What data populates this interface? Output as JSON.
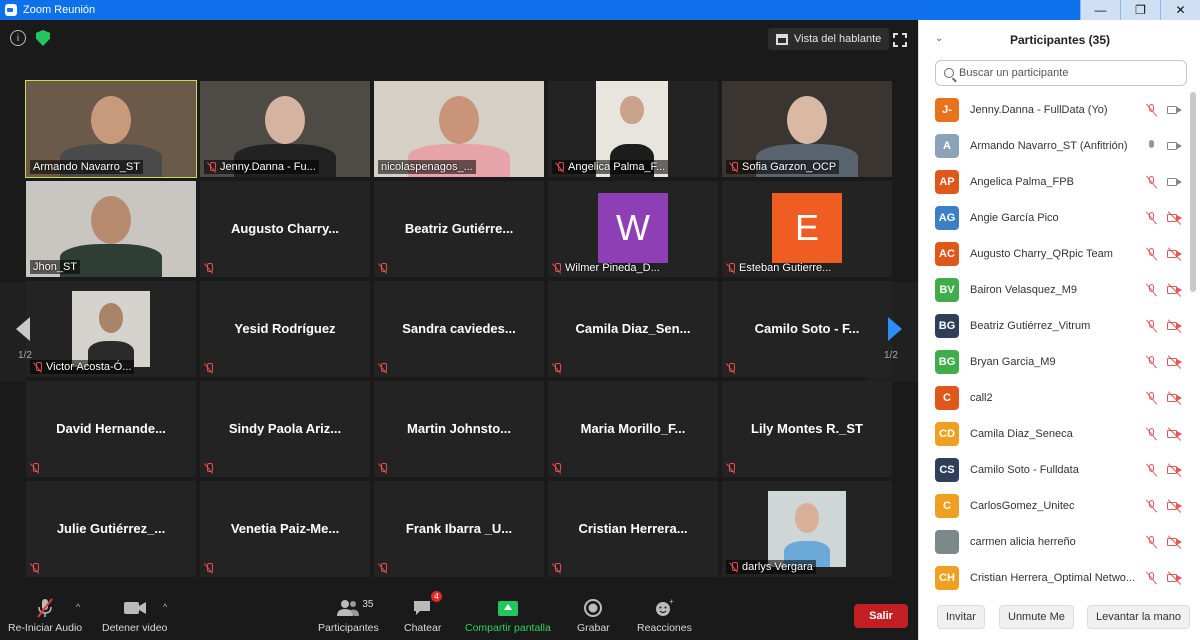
{
  "window": {
    "title": "Zoom Reunión",
    "minimize": "—",
    "maximize": "❐",
    "close": "✕"
  },
  "video": {
    "speaker_view_label": "Vista del hablante",
    "page_left": "1/2",
    "page_right": "1/2",
    "tiles": [
      {
        "name": "Armando Navarro_ST",
        "kind": "camera",
        "muted": false,
        "active": true,
        "bg": "#6b5a4a",
        "skin": "#c79a7c",
        "shirt": "#4a4a4a"
      },
      {
        "name": "Jenny.Danna - Fu...",
        "kind": "camera",
        "muted": true,
        "bg": "#4e4a45",
        "skin": "#d4b4a0",
        "shirt": "#222222"
      },
      {
        "name": "nicolaspenagos_...",
        "kind": "camera",
        "muted": false,
        "bg": "#d5cfc6",
        "skin": "#c99478",
        "shirt": "#e6a4a8"
      },
      {
        "name": "Angelica Palma_F...",
        "kind": "camera",
        "muted": true,
        "bg": "#e8e4de",
        "skin": "#c8a28a",
        "shirt": "#1d1d1d",
        "narrow": true
      },
      {
        "name": "Sofia Garzon_OCP",
        "kind": "camera",
        "muted": true,
        "bg": "#3a3530",
        "skin": "#d9b8a4",
        "shirt": "#5a6470"
      },
      {
        "name": "Jhon_ST",
        "kind": "camera",
        "muted": false,
        "bg": "#c9c6c2",
        "skin": "#b88a70",
        "shirt": "#2e3e34"
      },
      {
        "name": "Augusto Charry_QRpic Team",
        "display": "Augusto  Charry...",
        "kind": "name",
        "muted": true
      },
      {
        "name": "Beatriz Gutiérrez_Vitrum",
        "display": "Beatriz  Gutiérre...",
        "kind": "name",
        "muted": true
      },
      {
        "name": "Wilmer Pineda_D...",
        "kind": "avatar",
        "letter": "W",
        "color": "#8e3fb5",
        "muted": true
      },
      {
        "name": "Esteban Gutierre...",
        "kind": "avatar",
        "letter": "E",
        "color": "#f05d22",
        "muted": true
      },
      {
        "name": "Victor Acosta-Ó...",
        "kind": "photo",
        "muted": true,
        "bg": "#d6d3cf",
        "skin": "#a88468",
        "shirt": "#2a2a2a"
      },
      {
        "name": "Yesid Rodríguez",
        "display": "Yesid Rodríguez",
        "kind": "name",
        "muted": true
      },
      {
        "name": "Sandra caviedes",
        "display": "Sandra  caviedes...",
        "kind": "name",
        "muted": true
      },
      {
        "name": "Camila Diaz_Seneca",
        "display": "Camila  Diaz_Sen...",
        "kind": "name",
        "muted": true
      },
      {
        "name": "Camilo Soto - Fulldata",
        "display": "Camilo Soto - F...",
        "kind": "name",
        "muted": true
      },
      {
        "name": "David Hernandez",
        "display": "David  Hernande...",
        "kind": "name",
        "muted": true
      },
      {
        "name": "Sindy Paola Ariza",
        "display": "Sindy  Paola  Ariz...",
        "kind": "name",
        "muted": true
      },
      {
        "name": "Martin Johnston",
        "display": "Martin  Johnsto...",
        "kind": "name",
        "muted": true
      },
      {
        "name": "Maria Morillo",
        "display": "Maria  Morillo_F...",
        "kind": "name",
        "muted": true
      },
      {
        "name": "Lily Montes R._ST",
        "display": "Lily Montes R._ST",
        "kind": "name",
        "muted": true
      },
      {
        "name": "Julie Gutiérrez",
        "display": "Julie  Gutiérrez_...",
        "kind": "name",
        "muted": true
      },
      {
        "name": "Venetia Paiz-Me",
        "display": "Venetia  Paiz-Me...",
        "kind": "name",
        "muted": true
      },
      {
        "name": "Frank Ibarra",
        "display": "Frank Ibarra _U...",
        "kind": "name",
        "muted": true
      },
      {
        "name": "Cristian Herrera",
        "display": "Cristian  Herrera...",
        "kind": "name",
        "muted": true
      },
      {
        "name": "darlys Vergara",
        "kind": "photo",
        "muted": true,
        "bg": "#cfd6d8",
        "skin": "#d8b098",
        "shirt": "#6aa9d8"
      }
    ]
  },
  "toolbar": {
    "audio": "Re-Iniciar Audio",
    "video": "Detener video",
    "participants": "Participantes",
    "participants_count": "35",
    "chat": "Chatear",
    "chat_badge": "4",
    "share": "Compartir pantalla",
    "record": "Grabar",
    "reactions": "Reacciones",
    "leave": "Salir"
  },
  "panel": {
    "title": "Participantes (35)",
    "search_placeholder": "Buscar un participante",
    "participants": [
      {
        "initials": "J-",
        "name": "Jenny.Danna - FullData (Yo)",
        "color": "#e8731c",
        "mic": "muted",
        "video": "on"
      },
      {
        "initials": "A",
        "name": "Armando Navarro_ST (Anfitrión)",
        "color": "#8ba3b8",
        "mic": "on",
        "video": "on"
      },
      {
        "initials": "AP",
        "name": "Angelica Palma_FPB",
        "color": "#e0571a",
        "mic": "muted",
        "video": "on"
      },
      {
        "initials": "AG",
        "name": "Angie García Pico",
        "color": "#3b7fc4",
        "mic": "muted",
        "video": "off"
      },
      {
        "initials": "AC",
        "name": "Augusto Charry_QRpic Team",
        "color": "#e0571a",
        "mic": "muted",
        "video": "off"
      },
      {
        "initials": "BV",
        "name": "Bairon Velasquez_M9",
        "color": "#3fae4a",
        "mic": "muted",
        "video": "off"
      },
      {
        "initials": "BG",
        "name": "Beatriz Gutiérrez_Vitrum",
        "color": "#2f3f5a",
        "mic": "muted",
        "video": "off"
      },
      {
        "initials": "BG",
        "name": "Bryan Garcia_M9",
        "color": "#3fae4a",
        "mic": "muted",
        "video": "off"
      },
      {
        "initials": "C",
        "name": "call2",
        "color": "#e0571a",
        "mic": "muted",
        "video": "off"
      },
      {
        "initials": "CD",
        "name": "Camila Diaz_Seneca",
        "color": "#f0a020",
        "mic": "muted",
        "video": "off"
      },
      {
        "initials": "CS",
        "name": "Camilo Soto - Fulldata",
        "color": "#2f3f5a",
        "mic": "muted",
        "video": "off"
      },
      {
        "initials": "C",
        "name": "CarlosGomez_Unitec",
        "color": "#f0a020",
        "mic": "muted",
        "video": "off"
      },
      {
        "initials": "",
        "name": "carmen alicia herreño",
        "color": "#7a8a8a",
        "mic": "muted",
        "video": "off"
      },
      {
        "initials": "CH",
        "name": "Cristian Herrera_Optimal Netwo...",
        "color": "#f0a020",
        "mic": "muted",
        "video": "off"
      }
    ],
    "invite": "Invitar",
    "unmute": "Unmute Me",
    "raise_hand": "Levantar la mano"
  }
}
